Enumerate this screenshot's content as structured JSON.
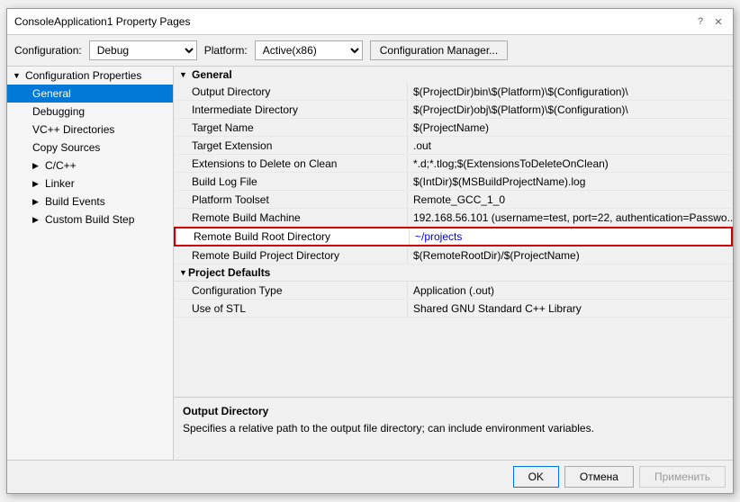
{
  "window": {
    "title": "ConsoleApplication1 Property Pages",
    "help_btn": "?",
    "close_btn": "✕"
  },
  "toolbar": {
    "config_label": "Configuration:",
    "config_value": "Debug",
    "platform_label": "Platform:",
    "platform_value": "Active(x86)",
    "config_manager_label": "Configuration Manager..."
  },
  "sidebar": {
    "items": [
      {
        "id": "config-props",
        "label": "Configuration Properties",
        "level": "parent",
        "arrow": "▼",
        "expanded": true
      },
      {
        "id": "general",
        "label": "General",
        "level": "child",
        "active": true
      },
      {
        "id": "debugging",
        "label": "Debugging",
        "level": "child"
      },
      {
        "id": "vc-directories",
        "label": "VC++ Directories",
        "level": "child"
      },
      {
        "id": "copy-sources",
        "label": "Copy Sources",
        "level": "child"
      },
      {
        "id": "cpp",
        "label": "C/C++",
        "level": "child-expand",
        "arrow": "▶"
      },
      {
        "id": "linker",
        "label": "Linker",
        "level": "child-expand",
        "arrow": "▶"
      },
      {
        "id": "build-events",
        "label": "Build Events",
        "level": "child-expand",
        "arrow": "▶"
      },
      {
        "id": "custom-build-step",
        "label": "Custom Build Step",
        "level": "child-expand",
        "arrow": "▶"
      }
    ]
  },
  "main": {
    "sections": [
      {
        "id": "general",
        "title": "General",
        "expanded": true,
        "rows": [
          {
            "name": "Output Directory",
            "value": "$(ProjectDir)bin\\$(Platform)\\$(Configuration)\\"
          },
          {
            "name": "Intermediate Directory",
            "value": "$(ProjectDir)obj\\$(Platform)\\$(Configuration)\\"
          },
          {
            "name": "Target Name",
            "value": "$(ProjectName)"
          },
          {
            "name": "Target Extension",
            "value": ".out"
          },
          {
            "name": "Extensions to Delete on Clean",
            "value": "*.d;*.tlog;$(ExtensionsToDeleteOnClean)"
          },
          {
            "name": "Build Log File",
            "value": "$(IntDir)$(MSBuildProjectName).log"
          },
          {
            "name": "Platform Toolset",
            "value": "Remote_GCC_1_0"
          },
          {
            "name": "Remote Build Machine",
            "value": "192.168.56.101 (username=test, port=22, authentication=Passwo..."
          },
          {
            "name": "Remote Build Root Directory",
            "value": "~/projects",
            "highlighted": true
          },
          {
            "name": "Remote Build Project Directory",
            "value": "$(RemoteRootDir)/$(ProjectName)"
          }
        ]
      },
      {
        "id": "project-defaults",
        "title": "Project Defaults",
        "expanded": true,
        "rows": [
          {
            "name": "Configuration Type",
            "value": "Application (.out)"
          },
          {
            "name": "Use of STL",
            "value": "Shared GNU Standard C++ Library"
          }
        ]
      }
    ],
    "bottom_panel": {
      "title": "Output Directory",
      "description": "Specifies a relative path to the output file directory; can include environment variables."
    }
  },
  "footer": {
    "ok_label": "OK",
    "cancel_label": "Отмена",
    "apply_label": "Применить"
  }
}
